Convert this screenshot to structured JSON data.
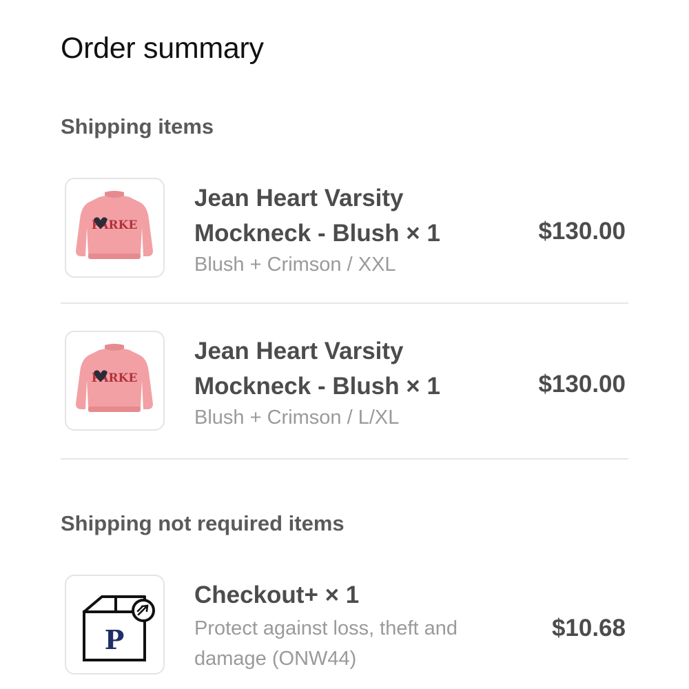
{
  "header": {
    "title": "Order summary"
  },
  "sections": [
    {
      "heading": "Shipping items",
      "items": [
        {
          "name_line1": "Jean Heart Varsity",
          "name_line2": "Mockneck - Blush × 1",
          "variant": "Blush + Crimson / XXL",
          "price": "$130.00",
          "thumb_icon": "pink-sweater-image",
          "thumb_text": "PARKE"
        },
        {
          "name_line1": "Jean Heart Varsity",
          "name_line2": "Mockneck - Blush × 1",
          "variant": "Blush + Crimson / L/XL",
          "price": "$130.00",
          "thumb_icon": "pink-sweater-image",
          "thumb_text": "PARKE"
        }
      ]
    },
    {
      "heading": "Shipping not required items",
      "items": [
        {
          "name_line1": "Checkout+ × 1",
          "desc_line1": "Protect against loss, theft and",
          "desc_line2": "damage (ONW44)",
          "price": "$10.68",
          "thumb_icon": "package-protection-icon",
          "thumb_text": "P"
        }
      ]
    }
  ],
  "colors": {
    "sweater": "#f2a0a4",
    "sweater_dark": "#e58b90",
    "lettering": "#b3313a",
    "package_letter": "#1f2f66"
  }
}
